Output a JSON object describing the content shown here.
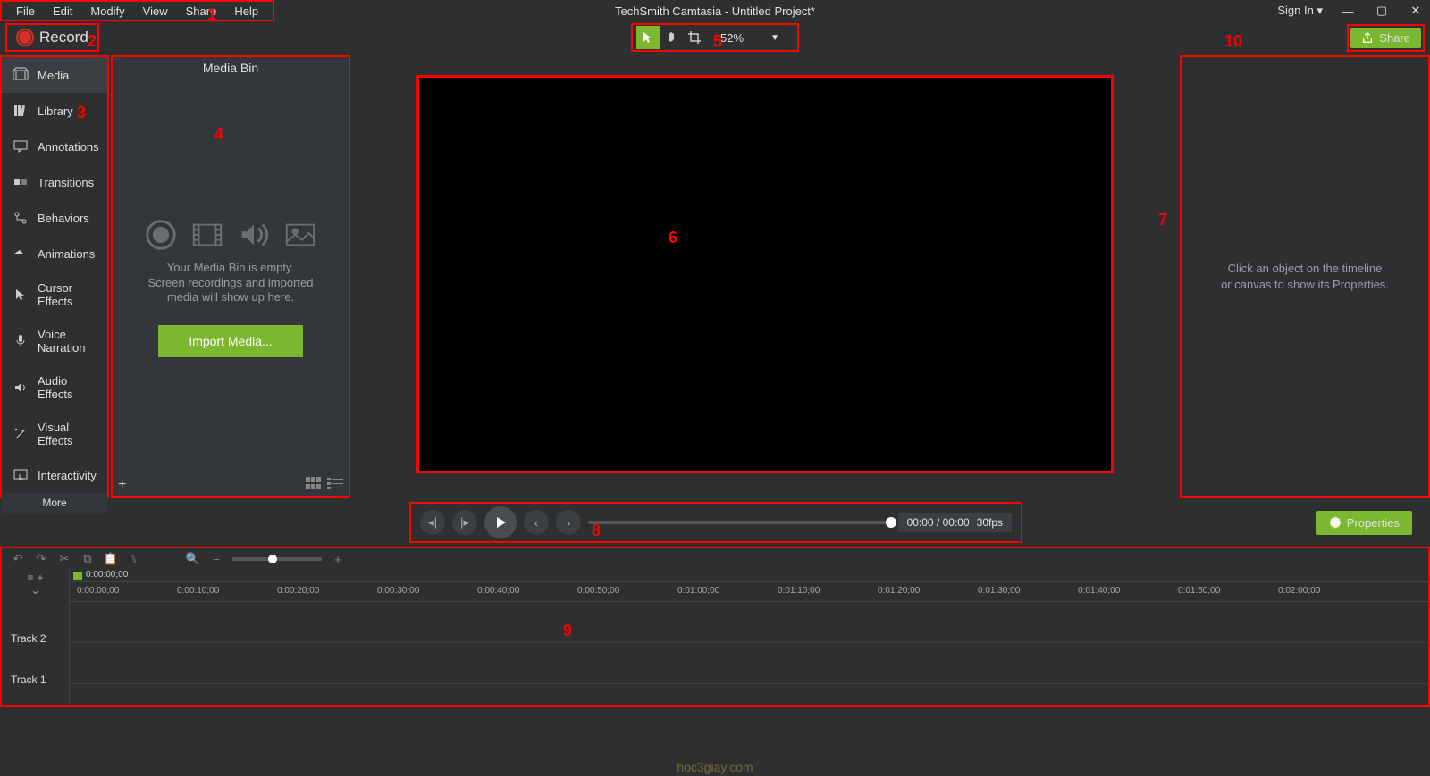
{
  "title_bar": {
    "menus": [
      "File",
      "Edit",
      "Modify",
      "View",
      "Share",
      "Help"
    ],
    "window_title": "TechSmith Camtasia - Untitled Project*",
    "sign_in": "Sign In"
  },
  "record_label": "Record",
  "canvas_tools": {
    "zoom": "52%"
  },
  "share_label": "Share",
  "tool_panel": {
    "items": [
      "Media",
      "Library",
      "Annotations",
      "Transitions",
      "Behaviors",
      "Animations",
      "Cursor Effects",
      "Voice Narration",
      "Audio Effects",
      "Visual Effects",
      "Interactivity"
    ],
    "more": "More"
  },
  "media_bin": {
    "title": "Media Bin",
    "empty_line": "Your Media Bin is empty.\nScreen recordings and imported\nmedia will show up here.",
    "import_label": "Import Media..."
  },
  "properties": {
    "hint": "Click an object on the timeline\nor canvas to show its Properties."
  },
  "playback": {
    "time": "00:00 / 00:00",
    "fps": "30fps"
  },
  "properties_btn": "Properties",
  "timeline": {
    "playhead_time": "0:00:00;00",
    "ruler_marks": [
      "0:00:00;00",
      "0:00:10;00",
      "0:00:20;00",
      "0:00:30;00",
      "0:00:40;00",
      "0:00:50;00",
      "0:01:00;00",
      "0:01:10;00",
      "0:01:20;00",
      "0:01:30;00",
      "0:01:40;00",
      "0:01:50;00",
      "0:02:00;00"
    ],
    "tracks": [
      "Track 2",
      "Track 1"
    ]
  },
  "annotations": {
    "1": "1",
    "2": "2",
    "3": "3",
    "4": "4",
    "5": "5",
    "6": "6",
    "7": "7",
    "8": "8",
    "9": "9",
    "10": "10"
  },
  "watermark": "hoc3giay.com"
}
